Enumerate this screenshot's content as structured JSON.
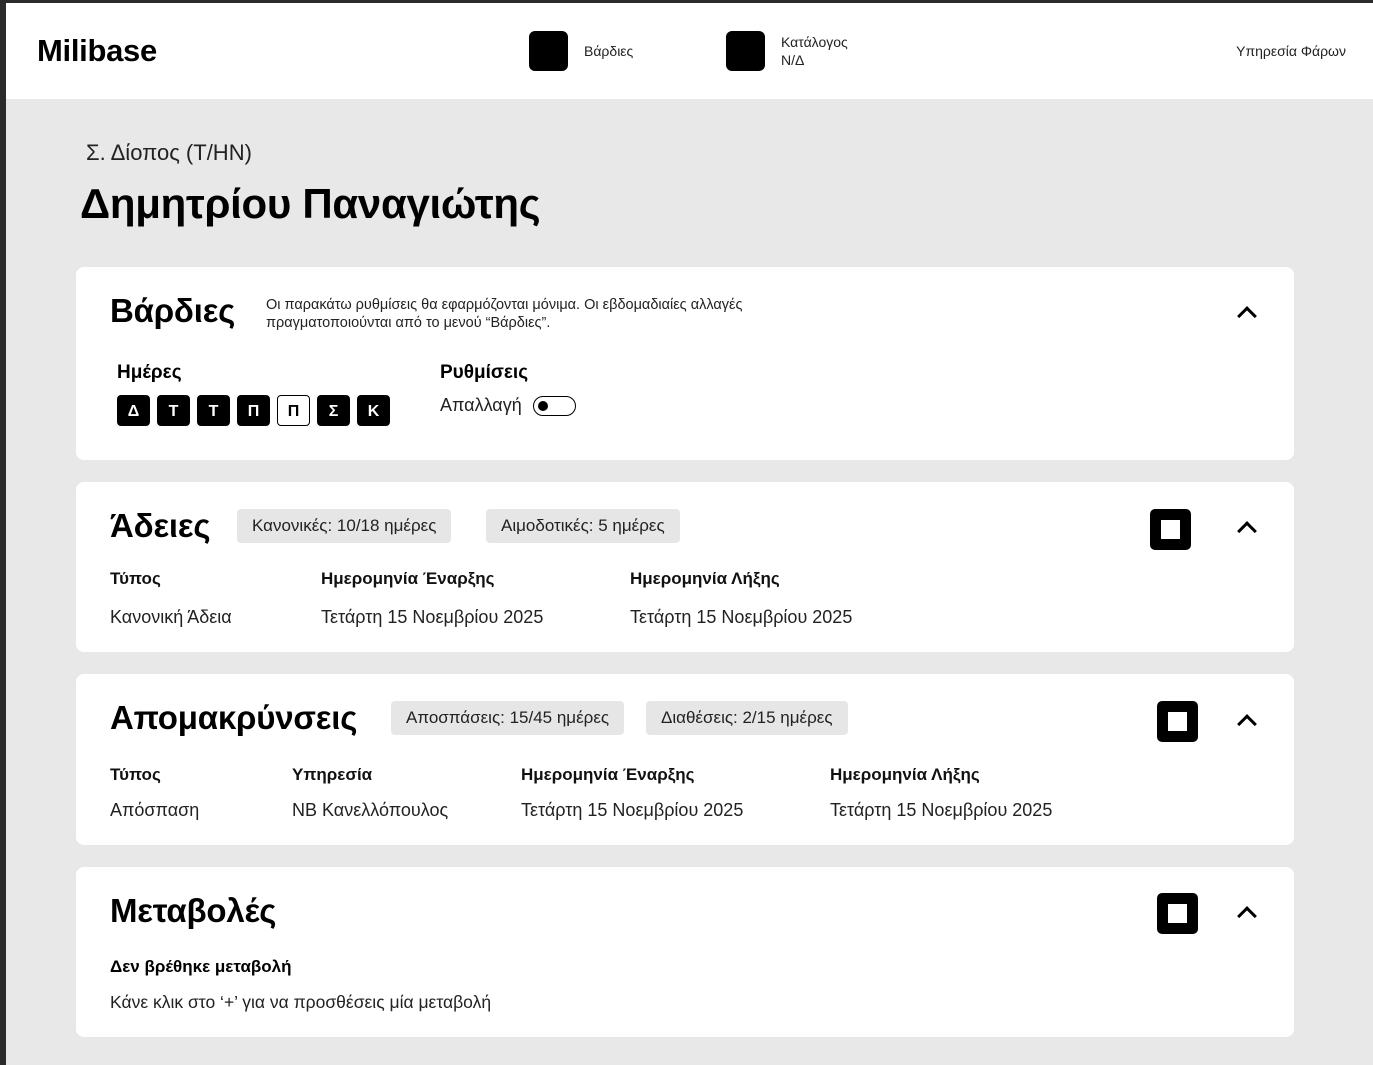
{
  "header": {
    "logo": "Milibase",
    "nav": [
      {
        "label": "Βάρδιες",
        "icon": "shifts-icon"
      },
      {
        "label": "Κατάλογος\nΝ/Δ",
        "icon": "catalog-icon"
      }
    ],
    "service": "Υπηρεσία Φάρων"
  },
  "person": {
    "rank": "Σ. Δίοπος (Τ/ΗΝ)",
    "name": "Δημητρίου Παναγιώτης"
  },
  "shifts": {
    "title": "Βάρδιες",
    "description": "Οι παρακάτω ρυθμίσεις θα εφαρμόζονται μόνιμα. Οι εβδομαδιαίες αλλαγές πραγματοποιούνται από το μενού “Βάρδιες”.",
    "days_label": "Ημέρες",
    "days": [
      {
        "label": "Δ",
        "active": true
      },
      {
        "label": "Τ",
        "active": true
      },
      {
        "label": "Τ",
        "active": true
      },
      {
        "label": "Π",
        "active": true
      },
      {
        "label": "Π",
        "active": false
      },
      {
        "label": "Σ",
        "active": true
      },
      {
        "label": "Κ",
        "active": true
      }
    ],
    "settings_label": "Ρυθμίσεις",
    "exemption_label": "Απαλλαγή",
    "exemption_on": false
  },
  "leaves": {
    "title": "Άδειες",
    "badges": [
      "Κανονικές: 10/18 ημέρες",
      "Αιμοδοτικές: 5 ημέρες"
    ],
    "columns": [
      "Τύπος",
      "Ημερομηνία Έναρξης",
      "Ημερομηνία Λήξης"
    ],
    "rows": [
      [
        "Κανονική Άδεια",
        "Τετάρτη 15 Νοεμβρίου 2025",
        "Τετάρτη 15 Νοεμβρίου 2025"
      ]
    ]
  },
  "removals": {
    "title": "Απομακρύνσεις",
    "badges": [
      "Αποσπάσεις: 15/45 ημέρες",
      "Διαθέσεις: 2/15 ημέρες"
    ],
    "columns": [
      "Τύπος",
      "Υπηρεσία",
      "Ημερομηνία Έναρξης",
      "Ημερομηνία Λήξης"
    ],
    "rows": [
      [
        "Απόσπαση",
        "ΝΒ Κανελλόπουλος",
        "Τετάρτη 15 Νοεμβρίου 2025",
        "Τετάρτη 15 Νοεμβρίου 2025"
      ]
    ]
  },
  "changes": {
    "title": "Μεταβολές",
    "empty_title": "Δεν βρέθηκε μεταβολή",
    "empty_hint": "Κάνε κλικ στο ‘+’ για να προσθέσεις μία μεταβολή"
  }
}
